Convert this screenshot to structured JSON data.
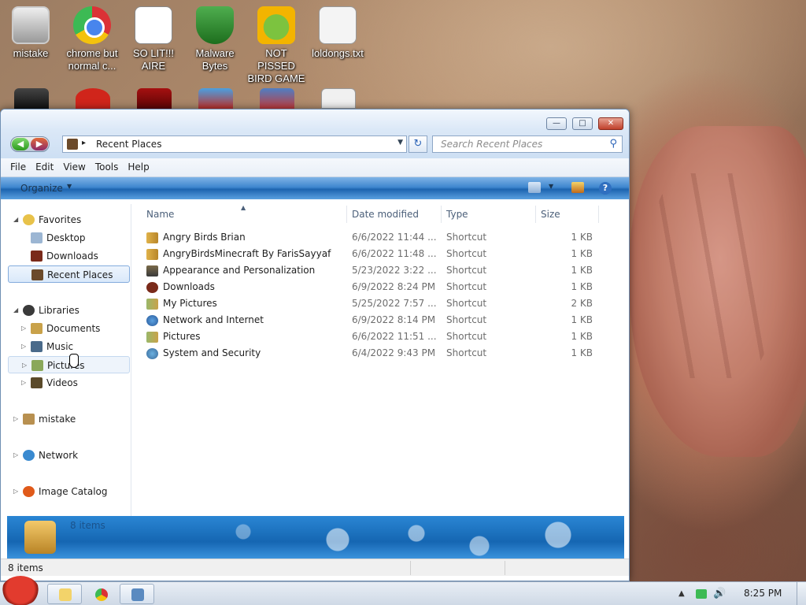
{
  "desktop": {
    "icons": [
      {
        "label": "mistake"
      },
      {
        "label": "chrome but normal c..."
      },
      {
        "label": "SO LIT!!! AIRE"
      },
      {
        "label": "Malware Bytes"
      },
      {
        "label": "NOT PISSED BIRD GAME"
      },
      {
        "label": "loldongs.txt"
      }
    ]
  },
  "window": {
    "address_path": "Recent Places",
    "search_placeholder": "Search Recent Places",
    "menu": [
      "File",
      "Edit",
      "View",
      "Tools",
      "Help"
    ],
    "organize_label": "Organize",
    "help_glyph": "?",
    "nav": {
      "favorites": "Favorites",
      "desktop": "Desktop",
      "downloads": "Downloads",
      "recent_places": "Recent Places",
      "libraries": "Libraries",
      "documents": "Documents",
      "music": "Music",
      "pictures": "Pictures",
      "videos": "Videos",
      "mistake": "mistake",
      "network": "Network",
      "image_catalog": "Image Catalog"
    },
    "columns": {
      "name": "Name",
      "date_modified": "Date modified",
      "type": "Type",
      "size": "Size"
    },
    "files": [
      {
        "name": "Angry Birds Brian",
        "date": "6/6/2022 11:44 ...",
        "type": "Shortcut",
        "size": "1 KB",
        "icon": "folder-shortcut-icon"
      },
      {
        "name": "AngryBirdsMinecraft By FarisSayyaf",
        "date": "6/6/2022 11:48 ...",
        "type": "Shortcut",
        "size": "1 KB",
        "icon": "folder-shortcut-icon"
      },
      {
        "name": "Appearance and Personalization",
        "date": "5/23/2022 3:22 ...",
        "type": "Shortcut",
        "size": "1 KB",
        "icon": "control-panel-icon"
      },
      {
        "name": "Downloads",
        "date": "6/9/2022 8:24 PM",
        "type": "Shortcut",
        "size": "1 KB",
        "icon": "downloads-icon"
      },
      {
        "name": "My Pictures",
        "date": "5/25/2022 7:57 ...",
        "type": "Shortcut",
        "size": "2 KB",
        "icon": "pictures-icon"
      },
      {
        "name": "Network and Internet",
        "date": "6/9/2022 8:14 PM",
        "type": "Shortcut",
        "size": "1 KB",
        "icon": "network-icon"
      },
      {
        "name": "Pictures",
        "date": "6/6/2022 11:51 ...",
        "type": "Shortcut",
        "size": "1 KB",
        "icon": "pictures-icon"
      },
      {
        "name": "System and Security",
        "date": "6/4/2022 9:43 PM",
        "type": "Shortcut",
        "size": "1 KB",
        "icon": "security-icon"
      }
    ],
    "details_count": "8 items",
    "status_text": "8 items"
  },
  "taskbar": {
    "clock": "8:25 PM"
  },
  "colors": {
    "accent": "#1d64b0",
    "selection": "#d9e8fa"
  }
}
